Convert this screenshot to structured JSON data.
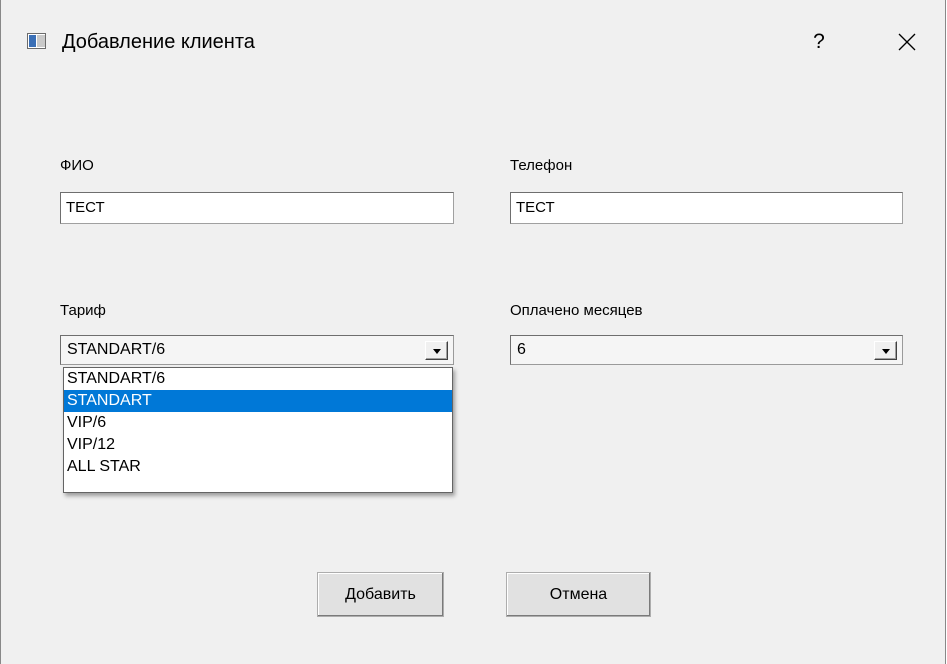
{
  "window": {
    "title": "Добавление клиента",
    "help_label": "?"
  },
  "form": {
    "fio": {
      "label": "ФИО",
      "value": "ТЕСТ"
    },
    "phone": {
      "label": "Телефон",
      "value": "ТЕСТ"
    },
    "tariff": {
      "label": "Тариф",
      "value": "STANDART/6",
      "options": [
        "STANDART/6",
        "STANDART",
        "VIP/6",
        "VIP/12",
        "ALL STAR"
      ],
      "highlighted": "STANDART"
    },
    "months_paid": {
      "label": "Оплачено месяцев",
      "value": "6"
    }
  },
  "buttons": {
    "add_label": "Добавить",
    "cancel_label": "Отмена"
  },
  "colors": {
    "selection": "#0078d7",
    "window_bg": "#f0f0f0"
  }
}
